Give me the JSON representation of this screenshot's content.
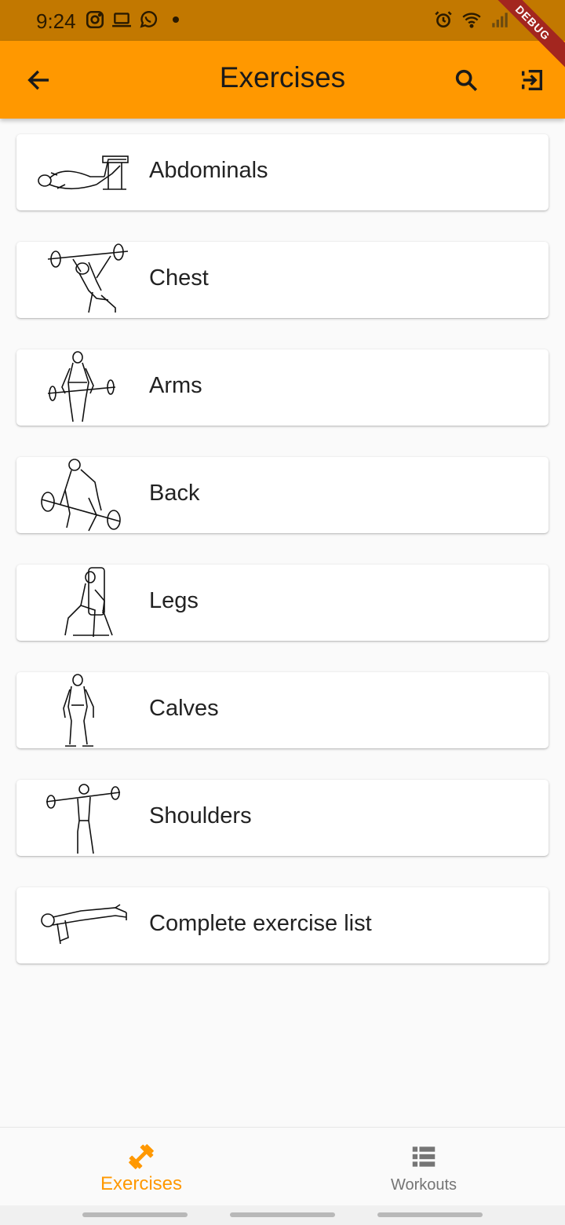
{
  "status_bar": {
    "time": "9:24",
    "left_icons": [
      "instagram-icon",
      "laptop-icon",
      "whatsapp-icon"
    ],
    "right_icons": [
      "alarm-icon",
      "wifi-icon",
      "signal-icon"
    ]
  },
  "debug_banner": "DEBUG",
  "app_bar": {
    "title": "Exercises",
    "background": "#ff9800"
  },
  "categories": [
    {
      "label": "Abdominals",
      "icon": "abdominals-figure-icon"
    },
    {
      "label": "Chest",
      "icon": "chest-figure-icon"
    },
    {
      "label": "Arms",
      "icon": "arms-figure-icon"
    },
    {
      "label": "Back",
      "icon": "back-figure-icon"
    },
    {
      "label": "Legs",
      "icon": "legs-figure-icon"
    },
    {
      "label": "Calves",
      "icon": "calves-figure-icon"
    },
    {
      "label": "Shoulders",
      "icon": "shoulders-figure-icon"
    },
    {
      "label": "Complete exercise list",
      "icon": "pushup-figure-icon"
    }
  ],
  "bottom_nav": {
    "items": [
      {
        "label": "Exercises",
        "icon": "dumbbell-icon",
        "active": true
      },
      {
        "label": "Workouts",
        "icon": "list-icon",
        "active": false
      }
    ],
    "accent": "#ff9800"
  }
}
